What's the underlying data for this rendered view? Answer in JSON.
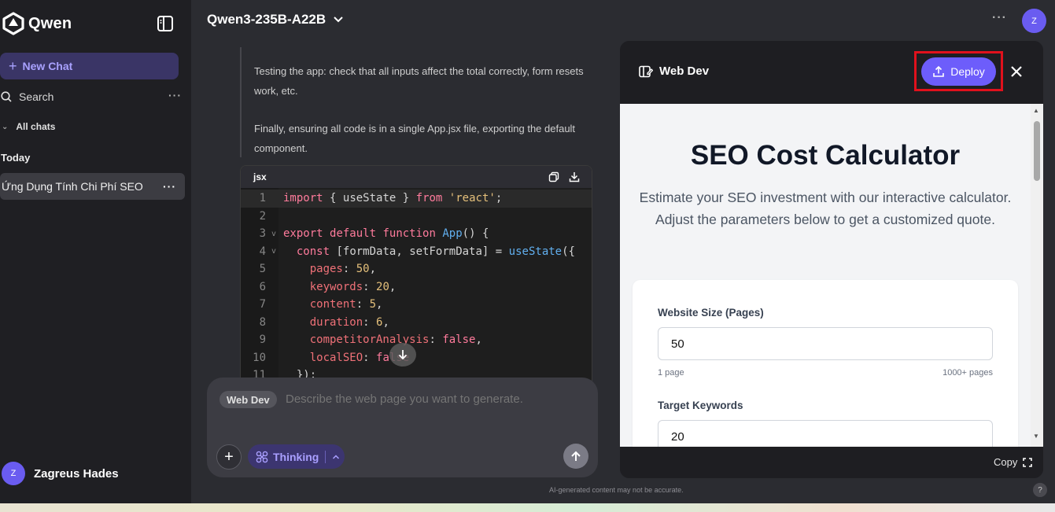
{
  "sidebar": {
    "brand": "Qwen",
    "new_chat": "New Chat",
    "search": "Search",
    "all_chats": "All chats",
    "section_today": "Today",
    "chats": [
      {
        "title": "Ứng Dụng Tính Chi Phí SEO"
      }
    ],
    "user": {
      "initial": "Z",
      "name": "Zagreus Hades"
    }
  },
  "header": {
    "model": "Qwen3-235B-A22B",
    "avatar_initial": "Z"
  },
  "chat": {
    "paragraphs": [
      "Testing the app: check that all inputs affect the total correctly, form resets work, etc.",
      "Finally, ensuring all code is in a single App.jsx file, exporting the default component."
    ],
    "code": {
      "language": "jsx",
      "lines": [
        "import { useState } from 'react';",
        "",
        "export default function App() {",
        "  const [formData, setFormData] = useState({",
        "    pages: 50,",
        "    keywords: 20,",
        "    content: 5,",
        "    duration: 6,",
        "    competitorAnalysis: false,",
        "    localSEO: false",
        "  });"
      ]
    }
  },
  "composer": {
    "mode_chip": "Web Dev",
    "placeholder": "Describe the web page you want to generate.",
    "thinking_label": "Thinking"
  },
  "disclaimer": "AI-generated content may not be accurate.",
  "help": "?",
  "panel": {
    "title": "Web Dev",
    "deploy_label": "Deploy",
    "copy_label": "Copy",
    "preview": {
      "title": "SEO Cost Calculator",
      "subtitle": "Estimate your SEO investment with our interactive calculator. Adjust the parameters below to get a customized quote.",
      "fields": [
        {
          "label": "Website Size (Pages)",
          "value": "50",
          "min_label": "1 page",
          "max_label": "1000+ pages"
        },
        {
          "label": "Target Keywords",
          "value": "20"
        }
      ]
    }
  },
  "colors": {
    "accent": "#6d5dfb",
    "highlight_box": "#e0111c",
    "sidebar_bg": "#1f1f23",
    "main_bg": "#2b2c31"
  }
}
